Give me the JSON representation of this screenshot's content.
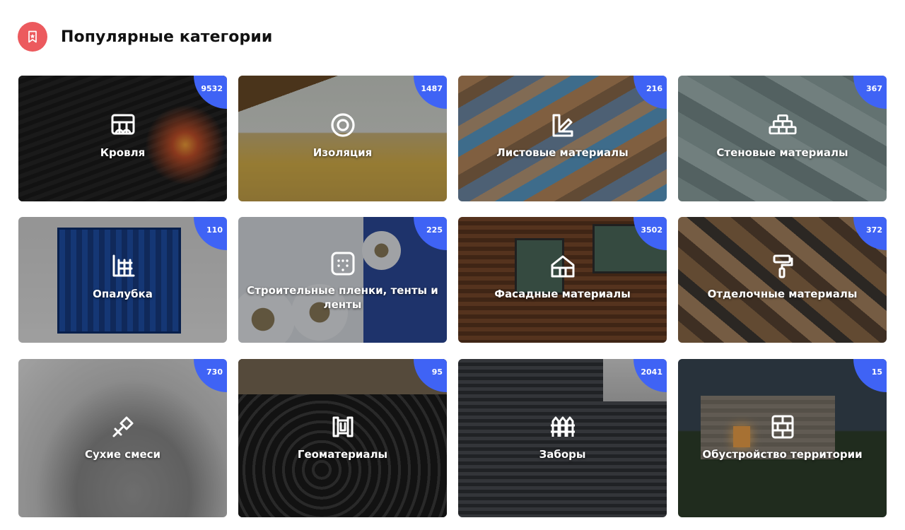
{
  "header": {
    "title": "Популярные категории",
    "icon": "bookmark-star-icon",
    "accent": "#ec5a5e"
  },
  "badge_color": "#3f63f5",
  "categories": [
    {
      "label": "Кровля",
      "count": "9532",
      "icon": "roof-tiles-icon"
    },
    {
      "label": "Изоляция",
      "count": "1487",
      "icon": "target-rings-icon"
    },
    {
      "label": "Листовые материалы",
      "count": "216",
      "icon": "sheet-layers-icon"
    },
    {
      "label": "Стеновые материалы",
      "count": "367",
      "icon": "brick-stack-icon"
    },
    {
      "label": "Опалубка",
      "count": "110",
      "icon": "formwork-grid-icon"
    },
    {
      "label": "Строительные пленки, тенты и ленты",
      "count": "225",
      "icon": "dotted-square-icon"
    },
    {
      "label": "Фасадные материалы",
      "count": "3502",
      "icon": "house-facade-icon"
    },
    {
      "label": "Отделочные материалы",
      "count": "372",
      "icon": "paint-roller-icon"
    },
    {
      "label": "Сухие смеси",
      "count": "730",
      "icon": "trowel-icon"
    },
    {
      "label": "Геоматериалы",
      "count": "95",
      "icon": "geogrid-icon"
    },
    {
      "label": "Заборы",
      "count": "2041",
      "icon": "picket-fence-icon"
    },
    {
      "label": "Обустройство территории",
      "count": "15",
      "icon": "paving-tiles-icon"
    }
  ]
}
